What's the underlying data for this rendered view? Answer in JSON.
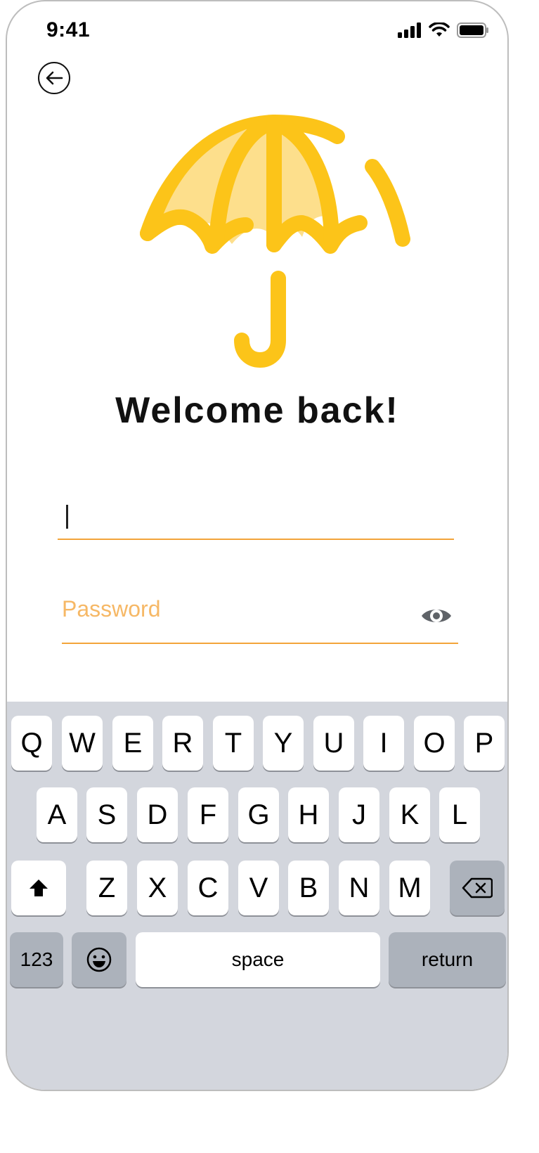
{
  "status_bar": {
    "time": "9:41"
  },
  "header": {
    "back_icon": "back-arrow-icon"
  },
  "logo": {
    "icon": "umbrella-icon",
    "colors": {
      "primary": "#fcc419",
      "light": "#fddf8c"
    }
  },
  "title": "Welcome back!",
  "form": {
    "username": {
      "value": "",
      "placeholder": ""
    },
    "password": {
      "placeholder": "Password",
      "visibility_icon": "eye-icon"
    }
  },
  "keyboard": {
    "row1": [
      "Q",
      "W",
      "E",
      "R",
      "T",
      "Y",
      "U",
      "I",
      "O",
      "P"
    ],
    "row2": [
      "A",
      "S",
      "D",
      "F",
      "G",
      "H",
      "J",
      "K",
      "L"
    ],
    "row3": [
      "Z",
      "X",
      "C",
      "V",
      "B",
      "N",
      "M"
    ],
    "shift_icon": "shift-icon",
    "backspace_icon": "backspace-icon",
    "numbers_label": "123",
    "emoji_icon": "emoji-icon",
    "space_label": "space",
    "return_label": "return"
  },
  "colors": {
    "accent": "#f3a43a",
    "placeholder": "#f6b866",
    "keyboard_bg": "#d3d6dd",
    "key_dark": "#acb2bb"
  }
}
